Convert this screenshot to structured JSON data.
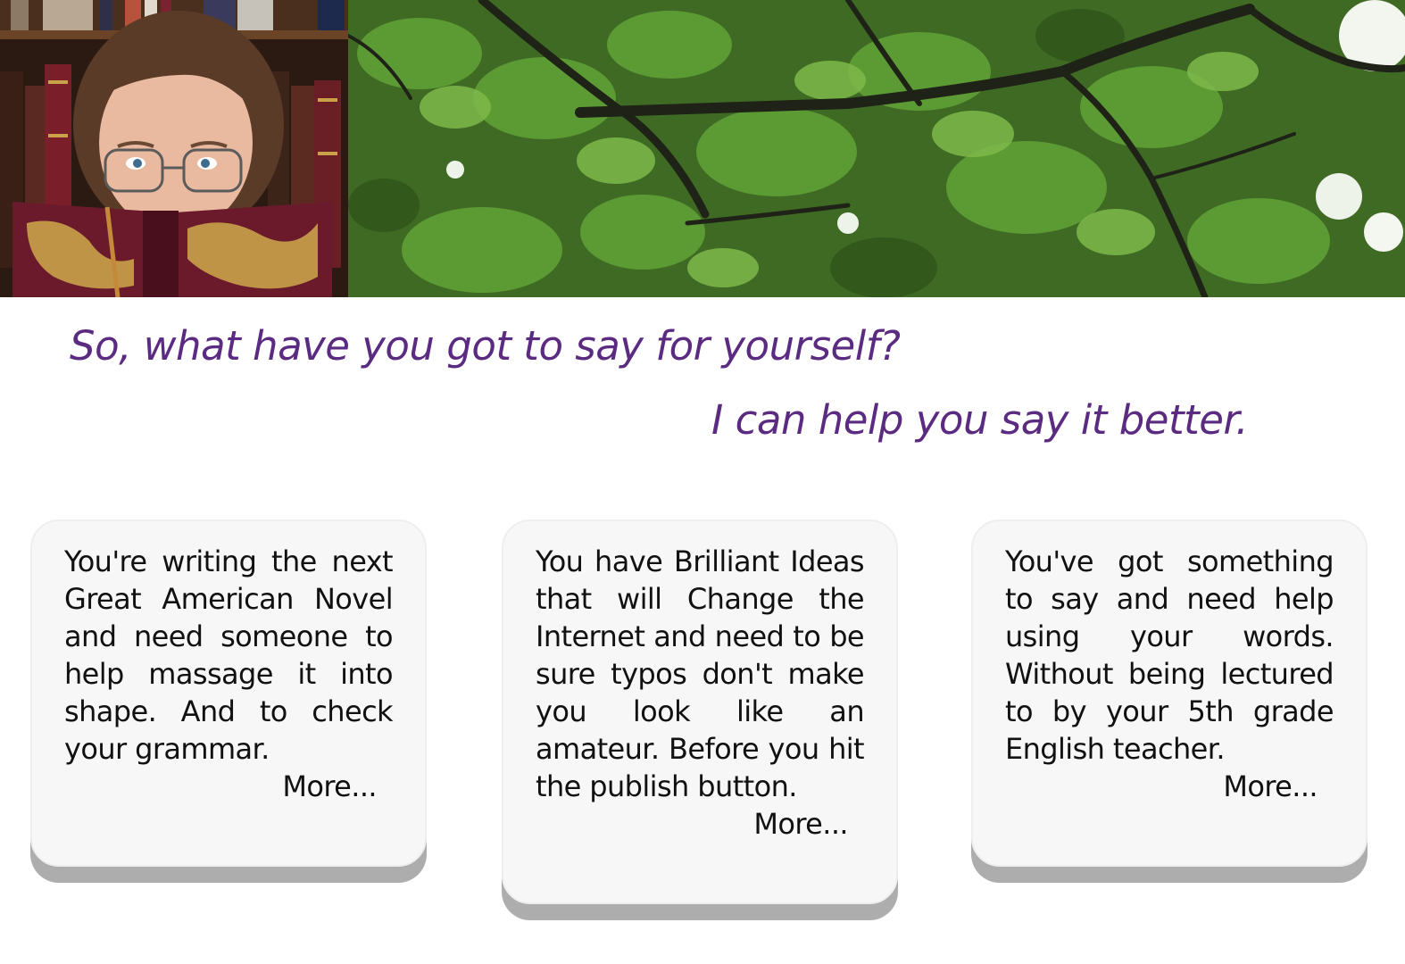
{
  "header": {
    "portrait_alt": "Woman peeking over an ornate book in front of a bookshelf",
    "canopy_alt": "Tree canopy of green leaves seen from below"
  },
  "taglines": {
    "line1": "So, what have you got to say for yourself?",
    "line2": "I can help you say it better."
  },
  "cards": [
    {
      "text": "You're writing the next Great American Novel and need someone to help massage it into shape. And to check your grammar.",
      "more_label": "More..."
    },
    {
      "text": "You have Brilliant Ideas that will Change the Internet and need to be sure typos don't make you look like an amateur. Before you hit the publish button.",
      "more_label": "More..."
    },
    {
      "text": "You've got something to say and need help using your words. Without being lectured to by your 5th grade English teacher.",
      "more_label": "More..."
    }
  ],
  "colors": {
    "tagline": "#5b2b82",
    "card_bg": "#f7f7f7",
    "card_shadow": "#adadad",
    "text": "#111111"
  }
}
